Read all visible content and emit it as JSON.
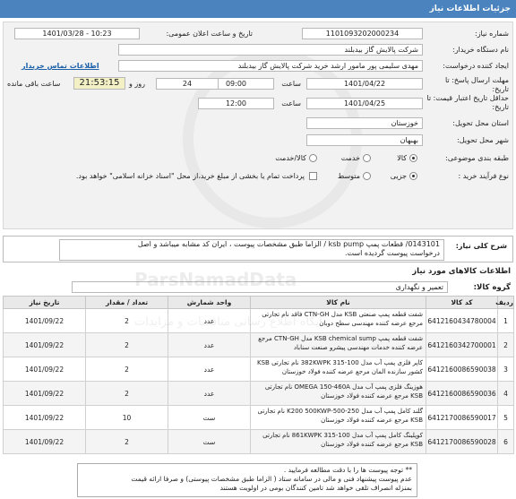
{
  "header": {
    "title": "جزئیات اطلاعات نیاز"
  },
  "form": {
    "need_number_label": "شماره نیاز:",
    "need_number": "1101093202000234",
    "announce_label": "تاریخ و ساعت اعلان عمومی:",
    "announce_value": "1401/03/28 - 10:23",
    "buyer_org_label": "نام دستگاه خریدار:",
    "buyer_org": "شرکت پالایش گاز بیدبلند",
    "creator_label": "ایجاد کننده درخواست:",
    "creator": "مهدی سلیمی پور مامور ارشد خرید شرکت پالایش گاز بیدبلند",
    "contact_link": "اطلاعات تماس خریدار",
    "deadline_label": "مهلت ارسال پاسخ: تا تاریخ:",
    "deadline_date": "1401/04/22",
    "deadline_time_label": "ساعت",
    "deadline_time": "09:00",
    "days_value": "24",
    "days_label": "روز و",
    "remaining_time": "21:53:15",
    "remaining_label": "ساعت باقی مانده",
    "min_valid_label": "حداقل تاریخ اعتبار قیمت: تا تاریخ:",
    "min_valid_date": "1401/04/25",
    "min_valid_time_label": "ساعت",
    "min_valid_time": "12:00",
    "province_label": "استان محل تحویل:",
    "province": "خوزستان",
    "city_label": "شهر محل تحویل:",
    "city": "بهبهان",
    "category_label": "طبقه بندی موضوعی:",
    "category_options": [
      "کالا",
      "خدمت",
      "کالا/خدمت"
    ],
    "process_label": "نوع فرآیند خرید :",
    "process_options": [
      "جزیی",
      "متوسط"
    ],
    "treasury_text": "پرداخت تمام یا بخشی از مبلغ خرید،از محل \"اسناد خزانه اسلامی\" خواهد بود."
  },
  "need": {
    "label": "شرح کلی نیاز:",
    "line1": "0143101/ قطعات پمپ  ksb  pump  / الزاما طبق مشخصات پیوست ، ایران کد مشابه میباشد و اصل",
    "line2": "درخواست پیوست گردیده است."
  },
  "goods": {
    "section_title": "اطلاعات کالاهای مورد نیاز",
    "group_label": "گروه کالا:",
    "group_value": "تعمیر و نگهداری",
    "columns": [
      "ردیف",
      "کد کالا",
      "نام کالا",
      "واحد شمارش",
      "تعداد / مقدار",
      "تاریخ نیاز"
    ],
    "rows": [
      {
        "no": "1",
        "code": "6412160434780004",
        "name": "شفت قطعه پمپ صنعتی KSB مدل CTN-GH فاقد نام تجارتی مرجع عرضه کننده مهندسی سطح دوبان",
        "unit": "عدد",
        "qty": "2",
        "date": "1401/09/22"
      },
      {
        "no": "2",
        "code": "6412160342700001",
        "name": "شفت قطعه پمپ KSB chemical sump مدل CTN-GH مرجع عرضه کننده خدمات مهندسی پیشرو صنعت سناباد",
        "unit": "عدد",
        "qty": "2",
        "date": "1401/09/22"
      },
      {
        "no": "3",
        "code": "6412160086590038",
        "name": "کاپر فلزی پمپ آب مدل 100-315 382KWPK نام تجارتی KSB کشور سازنده المان مرجع عرضه کننده فولاد خوزستان",
        "unit": "عدد",
        "qty": "2",
        "date": "1401/09/22"
      },
      {
        "no": "4",
        "code": "6412160086590036",
        "name": "هوزینگ فلزی پمپ آب مدل OMEGA 150-460A نام تجارتی KSB مرجع عرضه کننده فولاد خوزستان",
        "unit": "عدد",
        "qty": "2",
        "date": "1401/09/22"
      },
      {
        "no": "5",
        "code": "6412170086590017",
        "name": "گلند کامل پمپ آب مدل 250-500-K200 500KWP نام تجارتی KSB مرجع عرضه کننده فولاد خوزستان",
        "unit": "ست",
        "qty": "10",
        "date": "1401/09/22"
      },
      {
        "no": "6",
        "code": "6412170086590028",
        "name": "کوپلینگ کامل پمپ آب مدل 100-315 861KWPK نام تجارتی KSB مرجع عرضه کننده فولاد خوزستان",
        "unit": "ست",
        "qty": "2",
        "date": "1401/09/22"
      }
    ]
  },
  "notes": {
    "line1": "** توجه پیوست ها  را با دقت مطالعه فرمایید .",
    "line2": "عدم پیوست پیشنهاد فنی و مالی در سامانه ستاد ( الزاما طبق مشخصات پیوستی)  و صرفا ارائه قیمت",
    "line3": "بمنزله انصراف تلقی خواهد شد تامین کنندگان بومی در اولویت هستند"
  },
  "watermark": {
    "text1": "ParsNamadData",
    "text2": "پایگاه اطلاع رسانی مناقصات و مزایدات"
  },
  "colors": {
    "titlebar": "#4a83bd",
    "remaining_bg": "#f3f0c6",
    "link": "#1a5fa8"
  }
}
